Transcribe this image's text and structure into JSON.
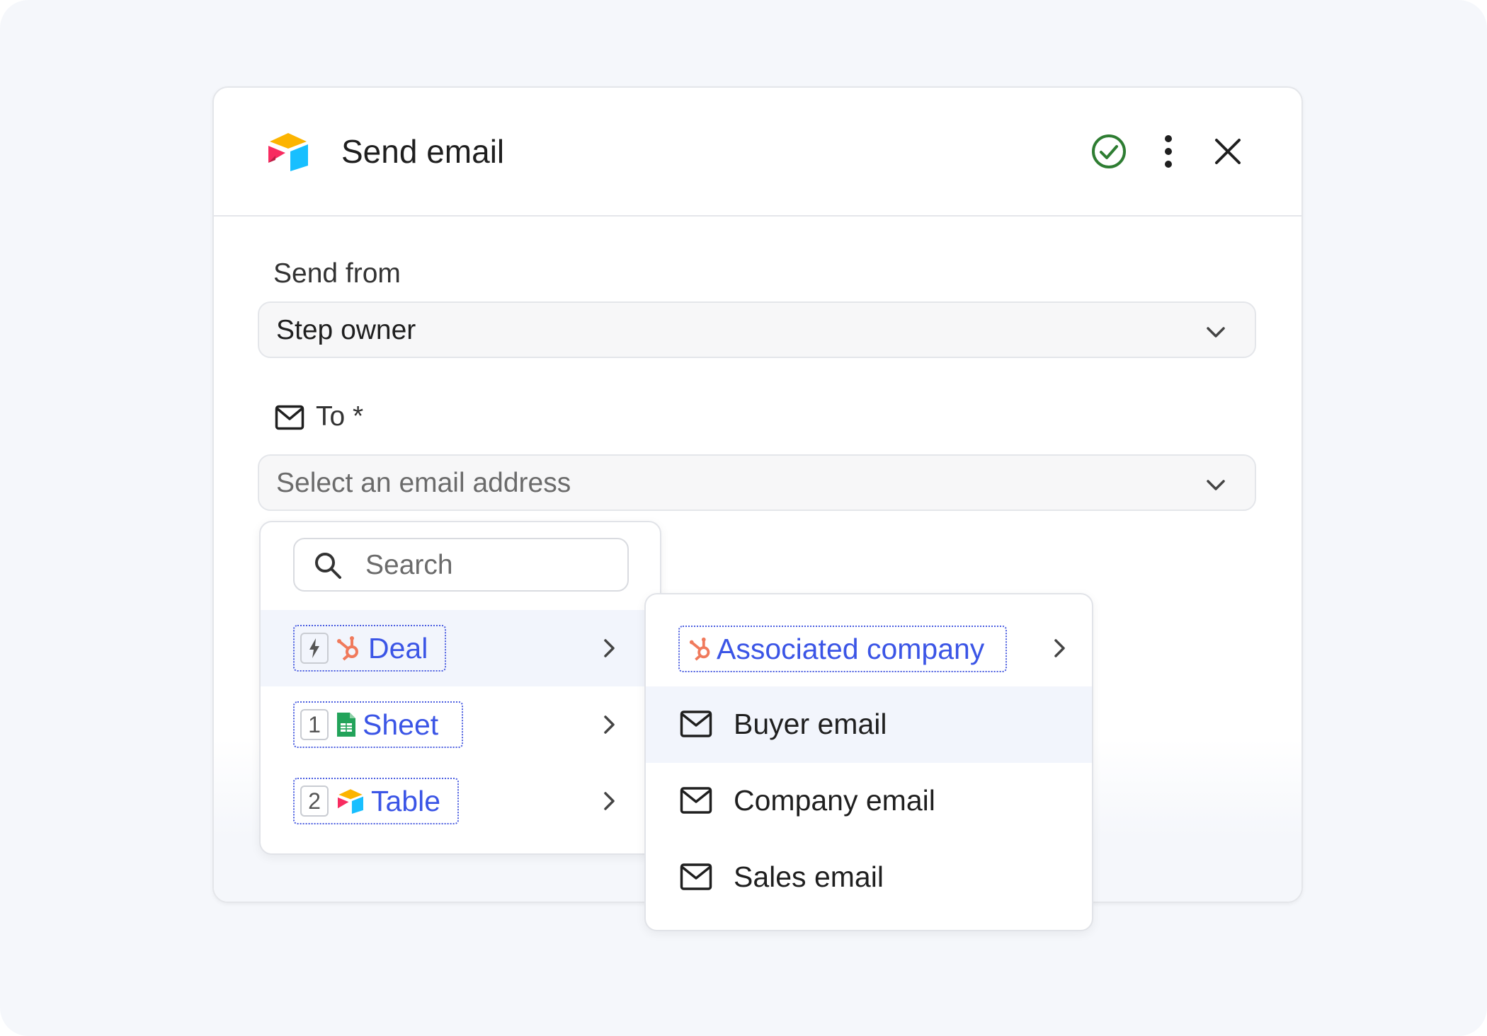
{
  "dialog": {
    "title": "Send email"
  },
  "send_from": {
    "label": "Send from",
    "value": "Step owner"
  },
  "to": {
    "label": "To *",
    "placeholder": "Select an email address"
  },
  "search": {
    "placeholder": "Search"
  },
  "sources": [
    {
      "badge": "",
      "label": "Deal",
      "icon": "hubspot-icon"
    },
    {
      "badge": "1",
      "label": "Sheet",
      "icon": "google-sheets-icon"
    },
    {
      "badge": "2",
      "label": "Table",
      "icon": "airtable-icon"
    }
  ],
  "submenu": {
    "associated": {
      "label": "Associated company",
      "icon": "hubspot-icon"
    },
    "fields": [
      {
        "label": "Buyer email",
        "icon": "mail-icon"
      },
      {
        "label": "Company email",
        "icon": "mail-icon"
      },
      {
        "label": "Sales email",
        "icon": "mail-icon"
      }
    ]
  },
  "colors": {
    "accent": "#3b55e6",
    "hubspot": "#f07a5c",
    "success": "#2e7d32",
    "sheets": "#22a35a"
  }
}
